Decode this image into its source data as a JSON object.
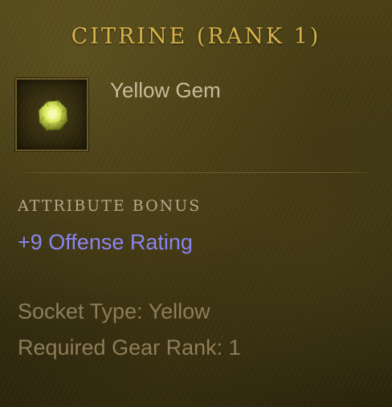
{
  "item": {
    "title": "CITRINE (RANK 1)",
    "subtitle": "Yellow Gem",
    "icon": "yellow-gem-icon"
  },
  "attributes": {
    "heading": "ATTRIBUTE BONUS",
    "bonus": "+9 Offense Rating"
  },
  "details": {
    "socket_type": "Socket Type: Yellow",
    "required_rank": "Required Gear Rank: 1"
  },
  "colors": {
    "title": "#d9b54a",
    "subtitle": "#c9bd9c",
    "heading": "#b7ab8e",
    "bonus": "#8a86f5",
    "details": "#8f7e58",
    "background": "#3d3512"
  }
}
